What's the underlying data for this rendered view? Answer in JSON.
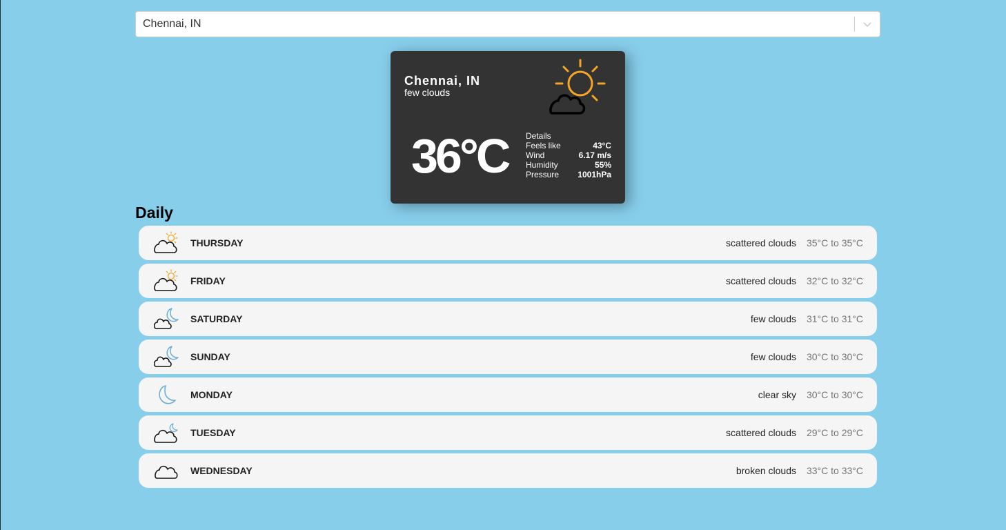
{
  "search": {
    "value": "Chennai, IN"
  },
  "current": {
    "city": "Chennai, IN",
    "description": "few clouds",
    "temperature": "36°C",
    "icon": "partly-cloudy-day-icon",
    "details": {
      "heading": "Details",
      "rows": [
        {
          "label": "Feels like",
          "value": "43°C"
        },
        {
          "label": "Wind",
          "value": "6.17 m/s"
        },
        {
          "label": "Humidity",
          "value": "55%"
        },
        {
          "label": "Pressure",
          "value": "1001hPa"
        }
      ]
    }
  },
  "daily": {
    "title": "Daily",
    "days": [
      {
        "day": "THURSDAY",
        "description": "scattered clouds",
        "range": "35°C to 35°C",
        "icon": "cloud-sun"
      },
      {
        "day": "FRIDAY",
        "description": "scattered clouds",
        "range": "32°C to 32°C",
        "icon": "cloud-sun"
      },
      {
        "day": "SATURDAY",
        "description": "few clouds",
        "range": "31°C to 31°C",
        "icon": "cloud-moon"
      },
      {
        "day": "SUNDAY",
        "description": "few clouds",
        "range": "30°C to 30°C",
        "icon": "cloud-moon"
      },
      {
        "day": "MONDAY",
        "description": "clear sky",
        "range": "30°C to 30°C",
        "icon": "moon"
      },
      {
        "day": "TUESDAY",
        "description": "scattered clouds",
        "range": "29°C to 29°C",
        "icon": "cloud-moon-small"
      },
      {
        "day": "WEDNESDAY",
        "description": "broken clouds",
        "range": "33°C to 33°C",
        "icon": "cloud"
      }
    ]
  },
  "colors": {
    "background": "#87ceeb",
    "card": "#333333",
    "sun": "#f5a623",
    "moon": "#6aaed6"
  }
}
